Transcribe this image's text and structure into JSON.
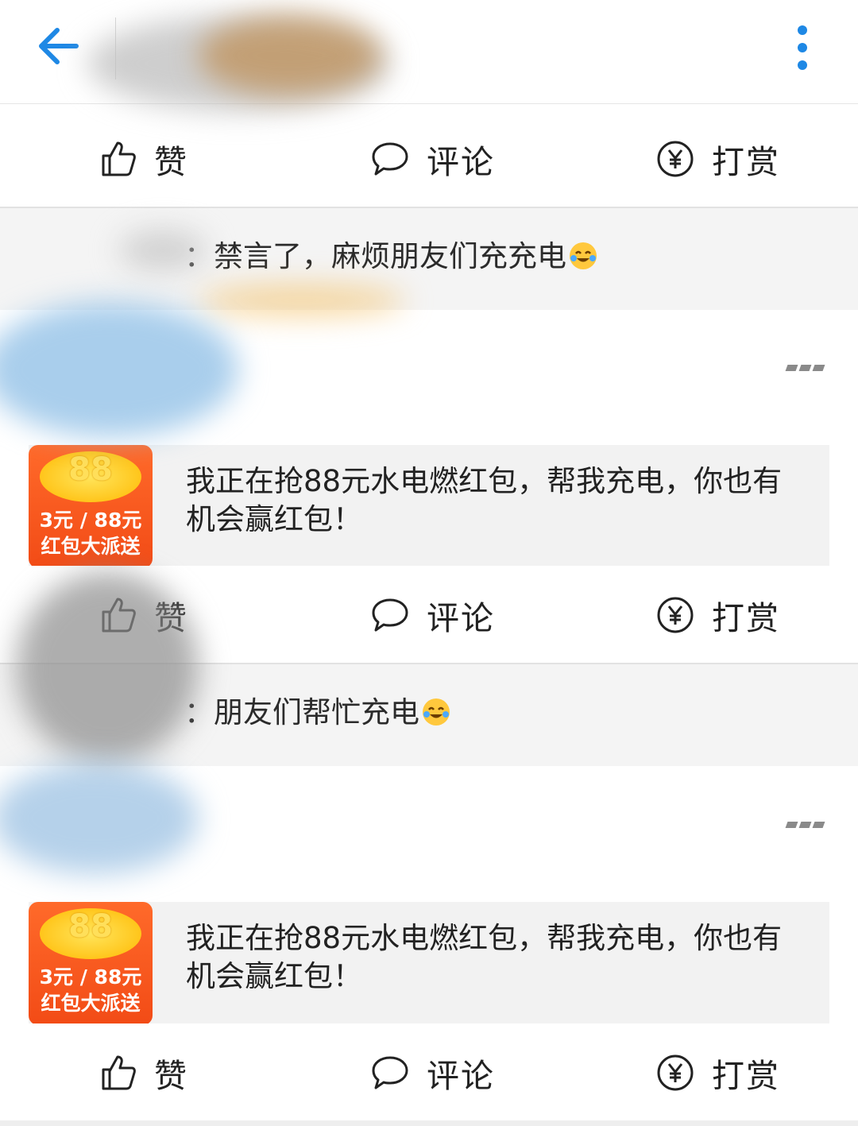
{
  "topbar": {
    "back_icon": "arrow-left-icon",
    "more_icon": "vertical-dots-icon",
    "accent_color": "#1e88e5"
  },
  "actions": {
    "like": "赞",
    "comment": "评论",
    "reward": "打赏"
  },
  "comments": [
    {
      "sep": "：",
      "text": "禁言了，麻烦朋友们充充电"
    },
    {
      "sep": "：",
      "text": "朋友们帮忙充电"
    }
  ],
  "share_card": {
    "thumb_coin": "88",
    "thumb_line1": "3元 / 88元",
    "thumb_line2": "红包大派送",
    "text": "我正在抢88元水电燃红包，帮我充电，你也有机会赢红包！"
  }
}
